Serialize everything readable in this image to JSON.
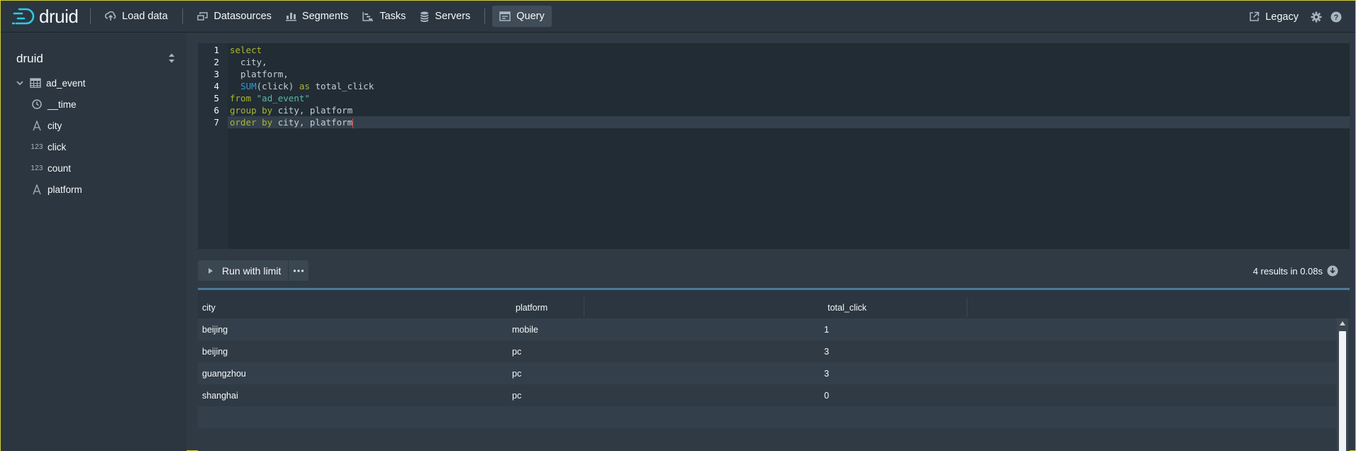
{
  "app": {
    "logo_text": "druid"
  },
  "nav": {
    "items": [
      {
        "label": "Load data",
        "icon": "cloud-upload-icon"
      },
      {
        "label": "Datasources",
        "icon": "multi-select-icon"
      },
      {
        "label": "Segments",
        "icon": "stacked-chart-icon"
      },
      {
        "label": "Tasks",
        "icon": "gantt-chart-icon"
      },
      {
        "label": "Servers",
        "icon": "database-icon"
      },
      {
        "label": "Query",
        "icon": "application-icon",
        "active": true
      }
    ],
    "legacy_label": "Legacy"
  },
  "sidebar": {
    "title": "druid",
    "datasource": "ad_event",
    "columns": [
      {
        "name": "__time",
        "type": "time"
      },
      {
        "name": "city",
        "type": "string"
      },
      {
        "name": "click",
        "type": "number",
        "type_label": "123"
      },
      {
        "name": "count",
        "type": "number",
        "type_label": "123"
      },
      {
        "name": "platform",
        "type": "string"
      }
    ]
  },
  "editor": {
    "line_numbers": [
      "1",
      "2",
      "3",
      "4",
      "5",
      "6",
      "7"
    ],
    "lines": [
      [
        {
          "t": "select",
          "c": "kw"
        }
      ],
      [
        {
          "t": "  city,",
          "c": ""
        }
      ],
      [
        {
          "t": "  platform,",
          "c": ""
        }
      ],
      [
        {
          "t": "  ",
          "c": ""
        },
        {
          "t": "SUM",
          "c": "fn"
        },
        {
          "t": "(click) ",
          "c": ""
        },
        {
          "t": "as",
          "c": "kw"
        },
        {
          "t": " total_click",
          "c": ""
        }
      ],
      [
        {
          "t": "from",
          "c": "kw"
        },
        {
          "t": " ",
          "c": ""
        },
        {
          "t": "\"ad_event\"",
          "c": "str"
        }
      ],
      [
        {
          "t": "group by",
          "c": "kw"
        },
        {
          "t": " city, platform",
          "c": ""
        }
      ],
      [
        {
          "t": "order by",
          "c": "kw"
        },
        {
          "t": " city, platform",
          "c": ""
        }
      ]
    ]
  },
  "run": {
    "label": "Run with limit"
  },
  "results": {
    "info": "4 results in 0.08s",
    "columns": [
      "city",
      "platform",
      "total_click"
    ],
    "rows": [
      [
        "beijing",
        "mobile",
        "1"
      ],
      [
        "beijing",
        "pc",
        "3"
      ],
      [
        "guangzhou",
        "pc",
        "3"
      ],
      [
        "shanghai",
        "pc",
        "0"
      ]
    ]
  },
  "colors": {
    "accent_border": "#4a7a9a",
    "keyword": "#a9b533",
    "function": "#2b9bd6",
    "string": "#56b6a8",
    "background": "#2f3a44"
  }
}
